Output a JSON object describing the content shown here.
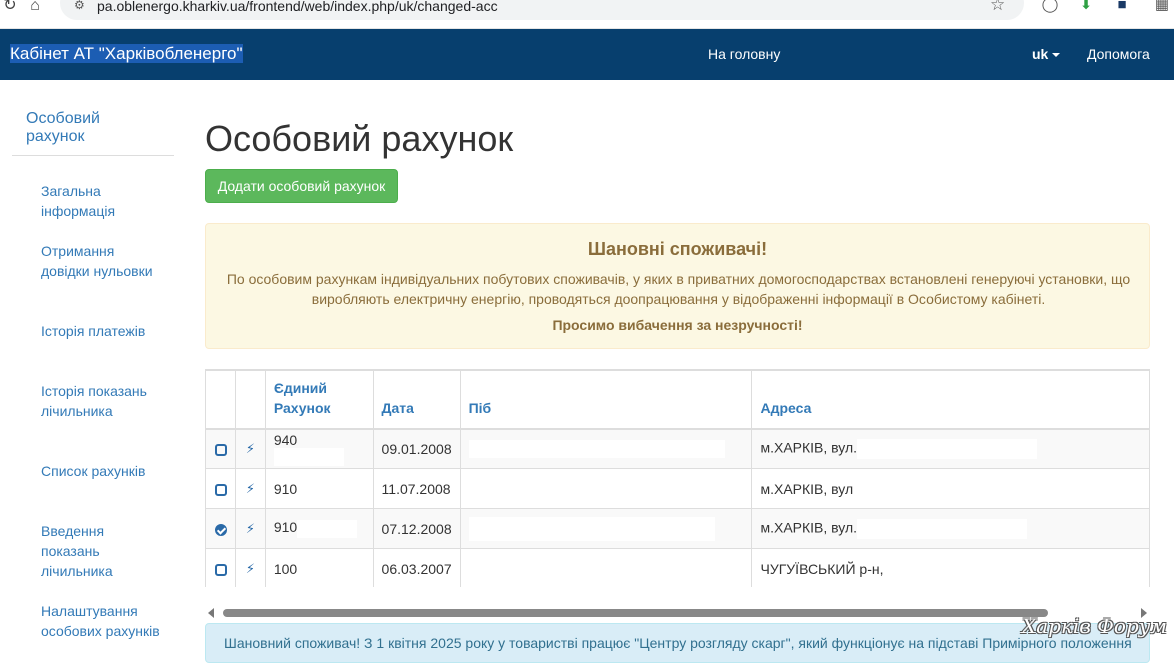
{
  "browser": {
    "url": "pa.oblenergo.kharkiv.ua/frontend/web/index.php/uk/changed-acc"
  },
  "navbar": {
    "brand": "Кабінет АТ \"Харківобленерго\"",
    "home": "На головну",
    "lang": "uk",
    "help": "Допомога"
  },
  "sidebar": {
    "title": "Особовий рахунок",
    "items": [
      {
        "label": "Загальна інформація"
      },
      {
        "label": "Отримання довідки нульовки"
      },
      {
        "label": "Історія платежів"
      },
      {
        "label": "Історія показань лічильника"
      },
      {
        "label": "Список рахунків"
      },
      {
        "label": "Введення показань лічильника"
      },
      {
        "label": "Налаштування особових рахунків"
      }
    ]
  },
  "main": {
    "title": "Особовий рахунок",
    "add_button": "Додати особовий рахунок",
    "alert": {
      "title": "Шановні споживачі!",
      "body": "По особовим рахункам індивідуальних побутових споживачів, у яких в приватних домогосподарствах встановлені генеруючі установки, що виробляють електричну енергію, проводяться доопрацювання у відображенні інформації в Особистому кабінеті.",
      "note": "Просимо вибачення за незручності!"
    },
    "table": {
      "headers": {
        "account": "Єдиний Рахунок",
        "date": "Дата",
        "name": "Піб",
        "address": "Адреса"
      },
      "rows": [
        {
          "account": "940",
          "date": "09.01.2008",
          "name": "",
          "address": "м.ХАРКІВ, вул.",
          "selected": false
        },
        {
          "account": "910",
          "date": "11.07.2008",
          "name": "",
          "address": "м.ХАРКІВ, вул",
          "selected": false
        },
        {
          "account": "910",
          "date": "07.12.2008",
          "name": "",
          "address": "м.ХАРКІВ, вул.",
          "selected": true
        },
        {
          "account": "100",
          "date": "06.03.2007",
          "name": "",
          "address": "ЧУГУЇВСЬКИЙ р-н,",
          "selected": false
        }
      ]
    },
    "info_alert": "Шановний споживач! З 1 квітня 2025 року у товаристві працює \"Центру розгляду скарг\", який функціонує на підставі Примірного положення",
    "watermark": "Харків Форум"
  },
  "colors": {
    "navbar": "#073f6e",
    "link": "#337ab7",
    "success": "#5cb85c",
    "warning_bg": "#fcf8e3",
    "warning_text": "#8a6d3b",
    "info_bg": "#d9edf7"
  }
}
